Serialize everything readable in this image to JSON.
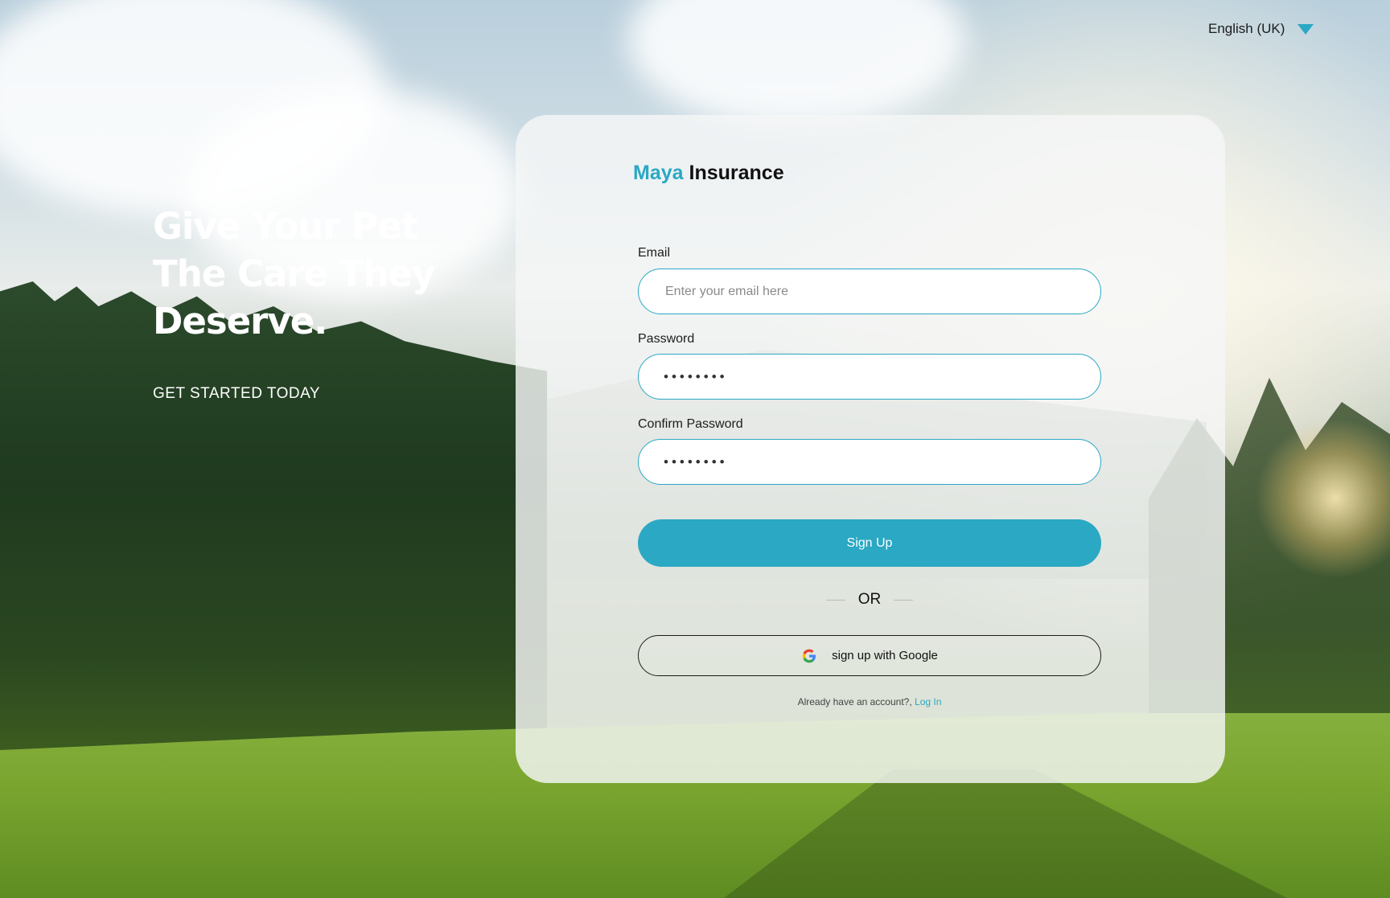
{
  "header": {
    "language": "English (UK)"
  },
  "hero": {
    "title_line1": "Give Your Pet",
    "title_line2": "The Care They",
    "title_line3": "Deserve.",
    "subtitle": "GET STARTED TODAY"
  },
  "brand": {
    "accent": "Maya",
    "name": "Insurance"
  },
  "form": {
    "email_label": "Email",
    "email_placeholder": "Enter your email here",
    "password_label": "Password",
    "password_mask": "••••••••",
    "confirm_label": "Confirm Password",
    "confirm_mask": "••••••••",
    "signup_label": "Sign Up",
    "or_label": "OR",
    "google_label": "sign up with Google",
    "account_prompt": "Already have an account?,",
    "login_label": "Log In"
  },
  "colors": {
    "accent": "#2aa8c4",
    "text": "#111111"
  },
  "icons": {
    "language_caret": "caret-down-icon",
    "google": "google-icon"
  }
}
